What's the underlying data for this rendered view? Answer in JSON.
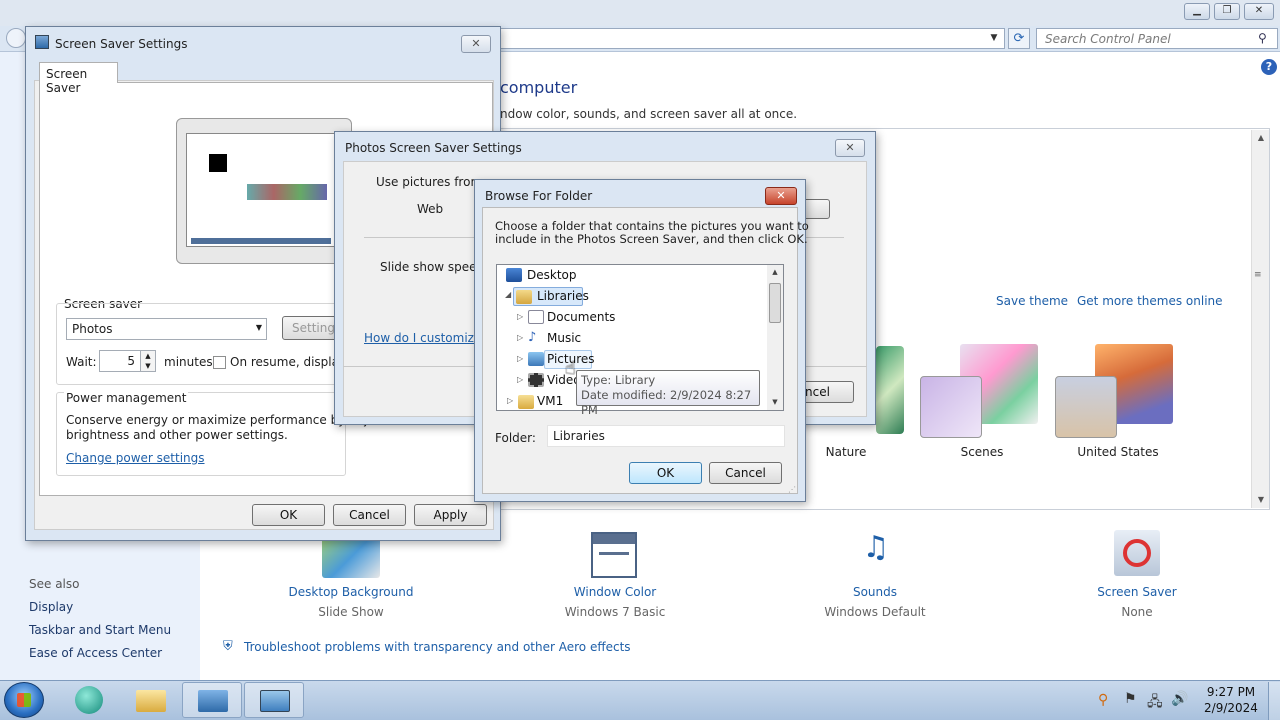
{
  "control_panel": {
    "search_placeholder": "Search Control Panel",
    "heading": "computer",
    "subheading": "ndow color, sounds, and screen saver all at once.",
    "links": {
      "save_theme": "Save theme",
      "more_themes": "Get more themes online"
    },
    "themes": [
      {
        "name": "Nature"
      },
      {
        "name": "Scenes"
      },
      {
        "name": "United States"
      }
    ],
    "bottom_items": [
      {
        "label": "Desktop Background",
        "sub": "Slide Show"
      },
      {
        "label": "Window Color",
        "sub": "Windows 7 Basic"
      },
      {
        "label": "Sounds",
        "sub": "Windows Default"
      },
      {
        "label": "Screen Saver",
        "sub": "None"
      }
    ],
    "troubleshoot": "Troubleshoot problems with transparency and other Aero effects",
    "see_also": {
      "title": "See also",
      "items": [
        "Display",
        "Taskbar and Start Menu",
        "Ease of Access Center"
      ]
    }
  },
  "screen_saver_dialog": {
    "title": "Screen Saver Settings",
    "tab": "Screen Saver",
    "group_label": "Screen saver",
    "selected_saver": "Photos",
    "settings_button": "Settings",
    "wait_label": "Wait:",
    "wait_value": "5",
    "minutes_label": "minutes",
    "resume_label": "On resume, display",
    "power_title": "Power management",
    "power_text_1": "Conserve energy or maximize performance by adju",
    "power_text_2": "brightness and other power settings.",
    "power_link": "Change power settings",
    "ok": "OK",
    "cancel": "Cancel",
    "apply": "Apply"
  },
  "photos_dialog": {
    "title": "Photos Screen Saver Settings",
    "use_pictures_label": "Use pictures from:",
    "use_pictures_value": "Web",
    "speed_label": "Slide show speed:",
    "help_link": "How do I customize",
    "cancel_partial": "ncel"
  },
  "browse_dialog": {
    "title": "Browse For Folder",
    "instructions_1": "Choose a folder that contains the pictures you want to",
    "instructions_2": "include in the Photos Screen Saver, and then click OK.",
    "tree": [
      {
        "label": "Desktop",
        "icon": "desktop-icon"
      },
      {
        "label": "Libraries",
        "icon": "libraries-icon"
      },
      {
        "label": "Documents",
        "icon": "documents-icon"
      },
      {
        "label": "Music",
        "icon": "music-icon"
      },
      {
        "label": "Pictures",
        "icon": "pictures-icon"
      },
      {
        "label": "Video",
        "icon": "video-icon"
      },
      {
        "label": "VM1",
        "icon": "folder-icon"
      }
    ],
    "tooltip_type": "Type: Library",
    "tooltip_date": "Date modified: 2/9/2024 8:27 PM",
    "folder_label": "Folder:",
    "folder_value": "Libraries",
    "ok": "OK",
    "cancel": "Cancel"
  },
  "taskbar": {
    "time": "9:27 PM",
    "date": "2/9/2024"
  }
}
